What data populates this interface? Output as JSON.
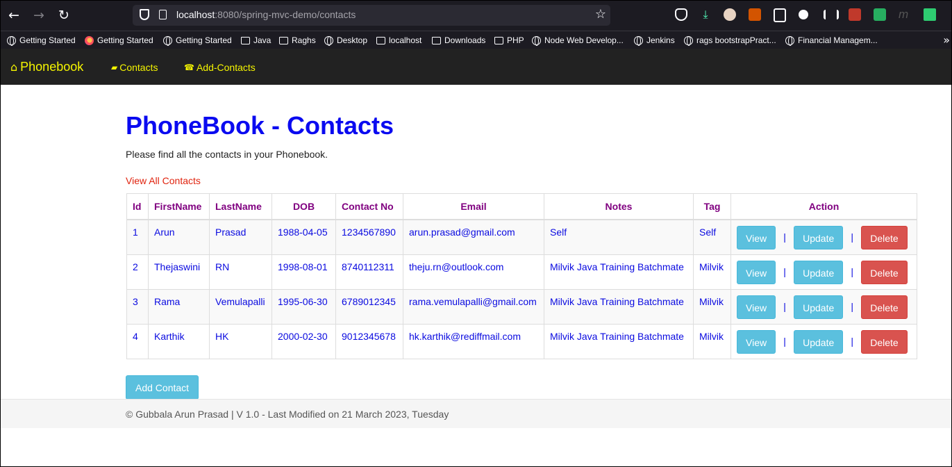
{
  "browser": {
    "url_host": "localhost",
    "url_path": ":8080/spring-mvc-demo/contacts",
    "bookmarks": [
      {
        "label": "Getting Started",
        "icon": "globe-icon"
      },
      {
        "label": "Getting Started",
        "icon": "firefox-icon"
      },
      {
        "label": "Getting Started",
        "icon": "globe-icon"
      },
      {
        "label": "Java",
        "icon": "folder-icon"
      },
      {
        "label": "Raghs",
        "icon": "folder-icon"
      },
      {
        "label": "Desktop",
        "icon": "globe-icon"
      },
      {
        "label": "localhost",
        "icon": "folder-icon"
      },
      {
        "label": "Downloads",
        "icon": "folder-icon"
      },
      {
        "label": "PHP",
        "icon": "folder-icon"
      },
      {
        "label": "Node Web Develop...",
        "icon": "globe-icon"
      },
      {
        "label": "Jenkins",
        "icon": "globe-icon"
      },
      {
        "label": "rags bootstrapPract...",
        "icon": "globe-icon"
      },
      {
        "label": "Financial Managem...",
        "icon": "globe-icon"
      }
    ]
  },
  "navbar": {
    "brand": "Phonebook",
    "links": [
      {
        "label": "Contacts",
        "icon": "book-icon"
      },
      {
        "label": "Add-Contacts",
        "icon": "phone-icon"
      }
    ],
    "text_color": "#f5f500"
  },
  "page": {
    "title": "PhoneBook - Contacts",
    "subtitle": "Please find all the contacts in your Phonebook.",
    "view_all_link": "View All Contacts",
    "add_button": "Add Contact"
  },
  "table": {
    "columns": [
      "Id",
      "FirstName",
      "LastName",
      "DOB",
      "Contact No",
      "Email",
      "Notes",
      "Tag",
      "Action"
    ],
    "rows": [
      {
        "id": "1",
        "first": "Arun",
        "last": "Prasad",
        "dob": "1988-04-05",
        "phone": "1234567890",
        "email": "arun.prasad@gmail.com",
        "notes": "Self",
        "tag": "Self"
      },
      {
        "id": "2",
        "first": "Thejaswini",
        "last": "RN",
        "dob": "1998-08-01",
        "phone": "8740112311",
        "email": "theju.rn@outlook.com",
        "notes": "Milvik Java Training Batchmate",
        "tag": "Milvik"
      },
      {
        "id": "3",
        "first": "Rama",
        "last": "Vemulapalli",
        "dob": "1995-06-30",
        "phone": "6789012345",
        "email": "rama.vemulapalli@gmail.com",
        "notes": "Milvik Java Training Batchmate",
        "tag": "Milvik"
      },
      {
        "id": "4",
        "first": "Karthik",
        "last": "HK",
        "dob": "2000-02-30",
        "phone": "9012345678",
        "email": "hk.karthik@rediffmail.com",
        "notes": "Milvik Java Training Batchmate",
        "tag": "Milvik"
      }
    ],
    "actions": {
      "view": "View",
      "update": "Update",
      "delete": "Delete",
      "separator": "|"
    }
  },
  "footer": {
    "text": "© Gubbala Arun Prasad | V 1.0 - Last Modified on 21 March 2023, Tuesday"
  },
  "colors": {
    "title": "#0a0af0",
    "header_text": "#800080",
    "cell_text": "#0a0ae0",
    "link_red": "#e0230e",
    "btn_info": "#5bc0de",
    "btn_danger": "#d9534f"
  }
}
